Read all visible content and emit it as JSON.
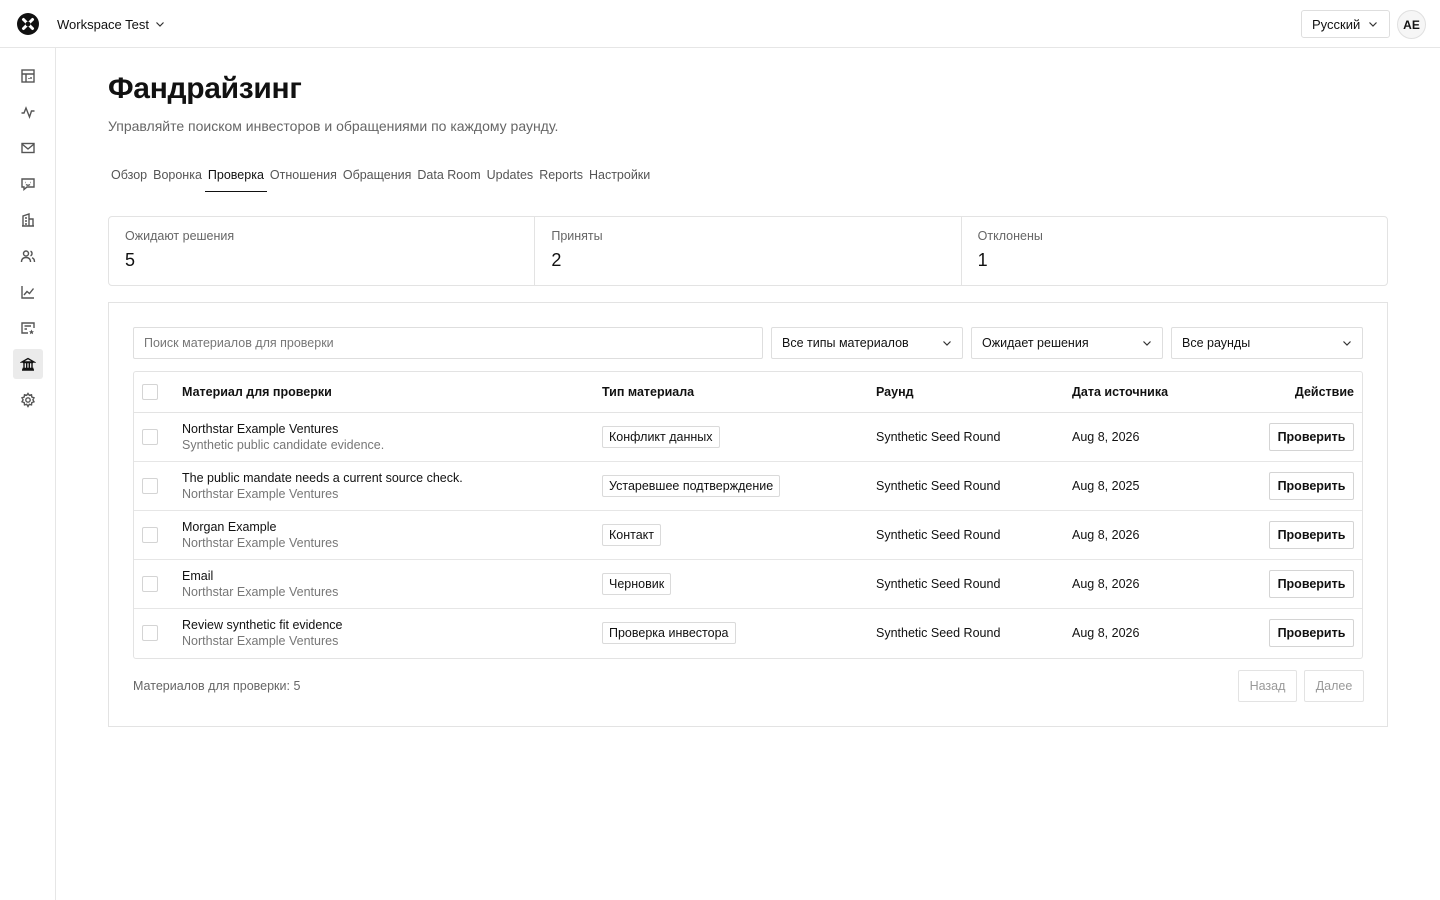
{
  "workspace": {
    "name": "Workspace Test"
  },
  "language": {
    "selected": "Русский"
  },
  "user": {
    "initials": "AE"
  },
  "sidebar": {
    "items": [
      {
        "name": "dashboard-icon"
      },
      {
        "name": "activity-icon"
      },
      {
        "name": "mail-icon"
      },
      {
        "name": "chat-icon"
      },
      {
        "name": "building-icon"
      },
      {
        "name": "users-icon"
      },
      {
        "name": "chart-icon"
      },
      {
        "name": "bookmark-card-icon"
      },
      {
        "name": "bank-icon"
      },
      {
        "name": "gear-icon"
      }
    ],
    "active_index": 8
  },
  "page": {
    "title": "Фандрайзинг",
    "subtitle": "Управляйте поиском инвесторов и обращениями по каждому раунду."
  },
  "tabs": [
    {
      "label": "Обзор"
    },
    {
      "label": "Воронка"
    },
    {
      "label": "Проверка"
    },
    {
      "label": "Отношения"
    },
    {
      "label": "Обращения"
    },
    {
      "label": "Data Room"
    },
    {
      "label": "Updates"
    },
    {
      "label": "Reports"
    },
    {
      "label": "Настройки"
    }
  ],
  "active_tab": "Проверка",
  "stats": [
    {
      "label": "Ожидают решения",
      "value": "5"
    },
    {
      "label": "Приняты",
      "value": "2"
    },
    {
      "label": "Отклонены",
      "value": "1"
    }
  ],
  "filters": {
    "search_placeholder": "Поиск материалов для проверки",
    "type": "Все типы материалов",
    "status": "Ожидает решения",
    "round": "Все раунды"
  },
  "table": {
    "headers": {
      "material": "Материал для проверки",
      "type": "Тип материала",
      "round": "Раунд",
      "date": "Дата источника",
      "action": "Действие"
    },
    "rows": [
      {
        "title": "Northstar Example Ventures",
        "subtitle": "Synthetic public candidate evidence.",
        "type": "Конфликт данных",
        "round": "Synthetic Seed Round",
        "date": "Aug 8, 2026",
        "action": "Проверить"
      },
      {
        "title": "The public mandate needs a current source check.",
        "subtitle": "Northstar Example Ventures",
        "type": "Устаревшее подтверждение",
        "round": "Synthetic Seed Round",
        "date": "Aug 8, 2025",
        "action": "Проверить"
      },
      {
        "title": "Morgan Example",
        "subtitle": "Northstar Example Ventures",
        "type": "Контакт",
        "round": "Synthetic Seed Round",
        "date": "Aug 8, 2026",
        "action": "Проверить"
      },
      {
        "title": "Email",
        "subtitle": "Northstar Example Ventures",
        "type": "Черновик",
        "round": "Synthetic Seed Round",
        "date": "Aug 8, 2026",
        "action": "Проверить"
      },
      {
        "title": "Review synthetic fit evidence",
        "subtitle": "Northstar Example Ventures",
        "type": "Проверка инвестора",
        "round": "Synthetic Seed Round",
        "date": "Aug 8, 2026",
        "action": "Проверить"
      }
    ]
  },
  "footer": {
    "count_label": "Материалов для проверки: 5",
    "prev": "Назад",
    "next": "Далее"
  }
}
